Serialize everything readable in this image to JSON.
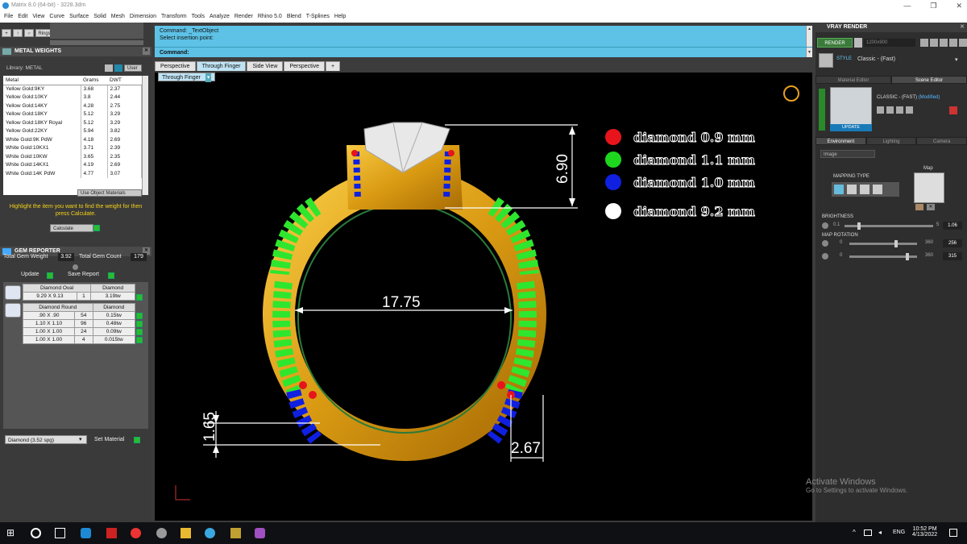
{
  "window": {
    "title": "Matrix 8.0 (64-bit) - 3228.3dm",
    "controls": [
      "—",
      "❐",
      "✕"
    ]
  },
  "menu": [
    "File",
    "Edit",
    "View",
    "Curve",
    "Surface",
    "Solid",
    "Mesh",
    "Dimension",
    "Transform",
    "Tools",
    "Analyze",
    "Render",
    "Rhino 5.0",
    "Blend",
    "T-Splines",
    "Help"
  ],
  "toolbar_left": {
    "rings_label": "Rings"
  },
  "metal_weights": {
    "title": "METAL WEIGHTS",
    "library": "Library: METAL",
    "user_label": "User",
    "columns": [
      "Metal",
      "Grams",
      "DWT"
    ],
    "rows": [
      [
        "Yellow Gold:9KY",
        "3.68",
        "2.37"
      ],
      [
        "Yellow Gold:10KY",
        "3.8",
        "2.44"
      ],
      [
        "Yellow Gold:14KY",
        "4.28",
        "2.75"
      ],
      [
        "Yellow Gold:18KY",
        "5.12",
        "3.29"
      ],
      [
        "Yellow Gold:18KY Royal",
        "5.12",
        "3.29"
      ],
      [
        "Yellow Gold:22KY",
        "5.94",
        "3.82"
      ],
      [
        "White Gold:9K PdW",
        "4.18",
        "2.69"
      ],
      [
        "White Gold:10KX1",
        "3.71",
        "2.39"
      ],
      [
        "White Gold:10KW",
        "3.65",
        "2.35"
      ],
      [
        "White Gold:14KX1",
        "4.19",
        "2.69"
      ],
      [
        "White Gold:14K PdW",
        "4.77",
        "3.07"
      ]
    ],
    "use_object_materials": "Use Object Materials",
    "hint": "Highlight the item you want to find the weight for then press Calculate.",
    "calculate": "Calculate"
  },
  "gem_reporter": {
    "title": "GEM REPORTER",
    "total_gem_weight_label": "Total Gem Weight",
    "total_gem_weight": "3.92",
    "total_gem_count_label": "Total Gem Count",
    "total_gem_count": "179",
    "update": "Update",
    "save_report": "Save Report",
    "groups": [
      {
        "shape": "Diamond Oval",
        "type": "Diamond",
        "rows": [
          [
            "9.29 X 9.13",
            "1",
            "3.19tw"
          ]
        ]
      },
      {
        "shape": "Diamond Round",
        "type": "Diamond",
        "rows": [
          [
            ".90 X .90",
            "54",
            "0.15tw"
          ],
          [
            "1.10 X 1.10",
            "96",
            "0.48tw"
          ],
          [
            "1.00 X 1.00",
            "24",
            "0.09tw"
          ],
          [
            "1.00 X 1.00",
            "4",
            "0.015tw"
          ]
        ]
      }
    ],
    "material_select": "Diamond     (3.52 spg)",
    "set_material": "Set Material"
  },
  "command": {
    "line1": "Command: _TextObject",
    "line2": "Select insertion point:",
    "prompt": "Command:"
  },
  "viewport_tabs": [
    "Perspective",
    "Through Finger",
    "Side View",
    "Perspective",
    "+"
  ],
  "active_tab": "Through Finger",
  "sub_tab": "Through Finger",
  "legend": [
    {
      "color": "#e8141b",
      "label": "diamond  0.9 mm"
    },
    {
      "color": "#1ed61e",
      "label": "diamond  1.1  mm"
    },
    {
      "color": "#1020e0",
      "label": "diamond  1.0  mm"
    },
    {
      "color": "#ffffff",
      "label": "diamond  9.2  mm"
    }
  ],
  "dimensions": {
    "height": "6.90",
    "inner": "17.75",
    "shank": "1.65",
    "width": "2.67"
  },
  "vray": {
    "title": "VRAY RENDER",
    "render": "RENDER",
    "resolution": "1200x900",
    "style": "Classic - (Fast)",
    "tabs": [
      "Material Editor",
      "Scene Editor"
    ],
    "material_name": "CLASSIC - (FAST)",
    "modified": "(Modified)",
    "update": "UPDATE",
    "env_tabs": [
      "Environment",
      "Lighting",
      "Camera"
    ],
    "image_select": "Image",
    "mapping_type": "MAPPING TYPE",
    "map_label": "Map",
    "brightness_label": "BRIGHTNESS",
    "brightness_min": "0.1",
    "brightness_max": "5",
    "brightness_value": "1.06",
    "map_rotation_label": "MAP ROTATION",
    "rot1_min": "0",
    "rot1_max": "360",
    "rot1_value": "256",
    "rot2_min": "0",
    "rot2_max": "360",
    "rot2_value": "315"
  },
  "watermark": {
    "line1": "Activate Windows",
    "line2": "Go to Settings to activate Windows."
  },
  "clock": {
    "time": "10:52 PM",
    "date": "4/13/2022",
    "lang": "ENG"
  }
}
